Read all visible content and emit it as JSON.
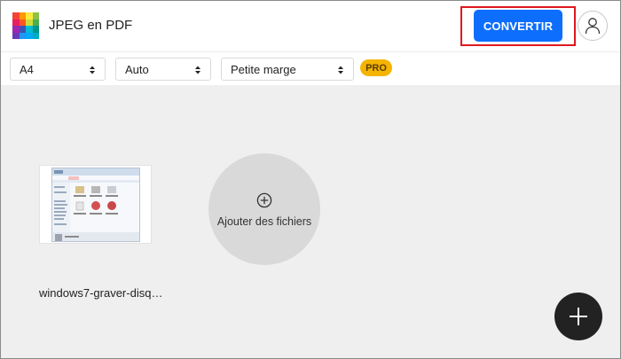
{
  "header": {
    "app_title": "JPEG en PDF",
    "convert_label": "CONVERTIR",
    "accent_color": "#0d6efd",
    "logo_icon": "colorful-grid-logo",
    "user_icon": "user-icon"
  },
  "toolbar": {
    "page_size": "A4",
    "orientation": "Auto",
    "margin": "Petite marge",
    "pro_badge": "PRO",
    "select_icon": "updown-chevron-icon"
  },
  "files": [
    {
      "name": "windows7-graver-disq…"
    }
  ],
  "add_files": {
    "label": "Ajouter des fichiers",
    "icon": "plus-circle-icon"
  },
  "fab": {
    "icon": "plus-icon"
  }
}
